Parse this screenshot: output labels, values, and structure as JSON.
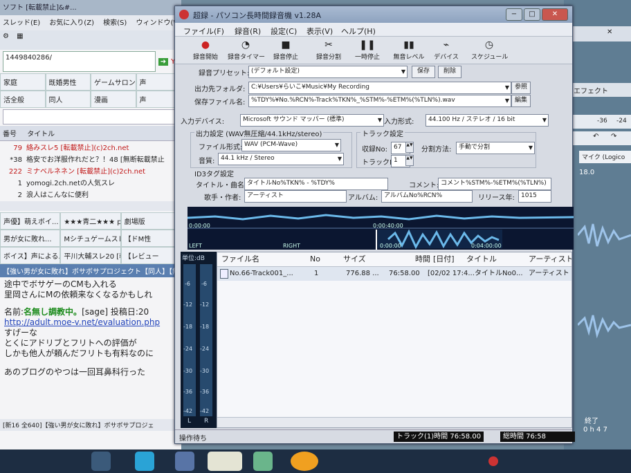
{
  "bg_browser": {
    "title": "ソフト [転載禁止]&#...",
    "menu": [
      "スレッド(E)",
      "お気に入り(Z)",
      "検索(S)",
      "ウィンドウ(W)"
    ],
    "url": "1449840286/",
    "search_hint": "Ya",
    "tabs": [
      "家庭",
      "既婚男性",
      "ゲームサロン",
      "声",
      "活全般",
      "同人",
      "漫画",
      "声"
    ],
    "list_header": {
      "num": "番号",
      "title": "タイトル"
    },
    "threads": [
      {
        "num": "79",
        "title": "絡みスレ5 [転載禁止](c)2ch.net",
        "red": true
      },
      {
        "num": "*38",
        "title": "格安でお洋服作れだと？！48 [無断転載禁止",
        "red": false
      },
      {
        "num": "222",
        "title": "ミナベルネネン [転載禁止](c)2ch.net",
        "red": true
      },
      {
        "num": "1",
        "title": "yomogi.2ch.netの人気スレ",
        "red": false
      },
      {
        "num": "2",
        "title": "浪人はこんなに便利",
        "red": false
      }
    ],
    "tabs2": [
      "声優】萌えボイ...",
      "★★★青二★★★ p...",
      "劇場版",
      "男が女に敗れ...",
      "Mシチュゲームスレッ...",
      "【ドM性",
      "ボイス】声による...",
      "平川大輔スレ20 [転...",
      "【レビュー"
    ],
    "bar_text": "【強い男が女に敗れ】ボサボサプロジェクト【同人】【無",
    "post_lines": [
      "途中でボサゲーのCMも入れる",
      "里岡さんにMの依頼来なくなるかもしれ"
    ],
    "post_name_label": "名前:",
    "post_name": "名無し調教中。",
    "post_sage": "[sage] 投稿日:20",
    "post_link": "http://adult.moe-v.net/evaluation.php",
    "post_lines2": [
      "すげーな",
      "とくにアドリブとフリトへの評価が",
      "しかも他人が頼んだフリトも有料なのに"
    ],
    "post_last": "あのブログのやつは一回耳鼻科行った",
    "status": "[新16 全640]【強い男が女に敗れ】ボサボサプロジェ"
  },
  "bg_right": {
    "label1": "エフェクト",
    "nums": [
      "-36",
      "-24"
    ],
    "mic": "マイク (Logico",
    "rate": "18.0",
    "end": "終了",
    "hm": "0 h 4 7"
  },
  "app": {
    "title": "超録 - パソコン長時間録音機 v1.28A",
    "menu": [
      "ファイル(F)",
      "録音(R)",
      "設定(C)",
      "表示(V)",
      "ヘルプ(H)"
    ],
    "toolbar": [
      {
        "label": "録音開始",
        "icon": "record-icon"
      },
      {
        "label": "録音タイマー",
        "icon": "timer-icon"
      },
      {
        "label": "録音停止",
        "icon": "stop-icon"
      },
      {
        "label": "録音分割",
        "icon": "split-icon"
      },
      {
        "label": "一時停止",
        "icon": "pause-icon"
      },
      {
        "label": "無音レベル",
        "icon": "level-icon"
      },
      {
        "label": "デバイス",
        "icon": "device-icon"
      },
      {
        "label": "スケジュール",
        "icon": "schedule-icon"
      }
    ],
    "preset": {
      "label": "録音プリセット:",
      "value": "(デフォルト設定)",
      "save": "保存",
      "delete": "削除"
    },
    "output_folder": {
      "label": "出力先フォルダ:",
      "value": "C:¥Users¥らいこ¥Music¥My Recording",
      "button": "参照"
    },
    "filename": {
      "label": "保存ファイル名:",
      "value": "%TDY%¥No.%RCN%-Track%TKN%_%STM%-%ETM%(%TLN%).wav",
      "button": "編集"
    },
    "input_device": {
      "label": "入力デバイス:",
      "value": "Microsoft サウンド マッパー (標準)"
    },
    "input_format": {
      "label": "入力形式:",
      "value": "44.100 Hz / ステレオ / 16 bit"
    },
    "output_group": {
      "title": "出力設定 (WAV無圧縮/44.1kHz/stereo)",
      "format_label": "ファイル形式:",
      "format_value": "WAV (PCM-Wave)",
      "quality_label": "音質:",
      "quality_value": "44.1 kHz / Stereo"
    },
    "track_group": {
      "title": "トラック設定",
      "rec_no_label": "収録No:",
      "rec_no": "67",
      "split_label": "分割方法:",
      "split_value": "手動で分割",
      "track_no_label": "トラックNo:",
      "track_no": "1"
    },
    "id3_group": {
      "title": "ID3タグ設定",
      "title_label": "タイトル・曲名:",
      "title_value": "タイトルNo%TKN% - %TDY%",
      "comment_label": "コメント:",
      "comment_value": "コメント%STM%-%ETM%(%TLN%)",
      "artist_label": "歌手・作者:",
      "artist_value": "アーティスト",
      "album_label": "アルバム:",
      "album_value": "アルバムNo%RCN%",
      "year_label": "リリース年:",
      "year_value": "1015"
    },
    "wave": {
      "t0": "0:00:00",
      "t1": "0:00:40:00",
      "t2": "0:00:00",
      "t3": "0:04:00:00",
      "left": "LEFT",
      "right": "RIGHT"
    },
    "meter": {
      "unit": "単位:dB",
      "ticks": [
        "-6",
        "-12",
        "-18",
        "-24",
        "-30",
        "-36",
        "-42"
      ],
      "l": "L",
      "r": "R"
    },
    "list": {
      "columns": [
        "ファイル名",
        "No",
        "サイズ",
        "時間",
        "[日付]",
        "タイトル",
        "アーティスト"
      ],
      "rows": [
        {
          "file": "No.66-Track001_...",
          "no": "1",
          "size": "776.88 ...",
          "time": "76:58.00",
          "date": "[02/02 17:4...",
          "title": "タイトルNo0...",
          "artist": "アーティスト"
        }
      ]
    },
    "status": {
      "left": "操作待ち",
      "track": "トラック(1)時間 76:58.00",
      "total": "総時間 76:58"
    }
  }
}
